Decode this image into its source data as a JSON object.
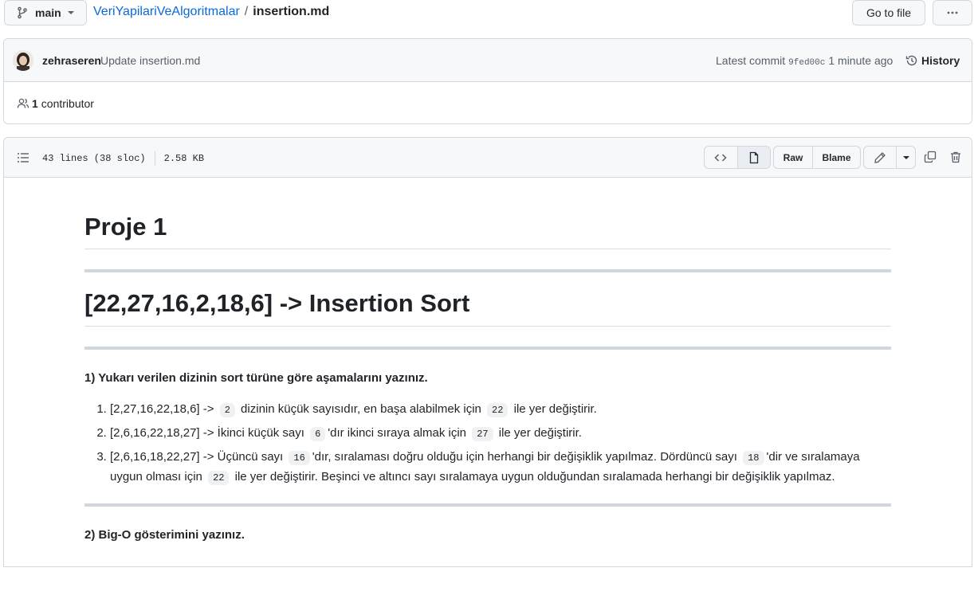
{
  "topbar": {
    "branch": "main",
    "repo": "VeriYapilariVeAlgoritmalar",
    "separator": "/",
    "file": "insertion.md",
    "goto_file": "Go to file",
    "more_icon": "kebab-horizontal-icon"
  },
  "commit": {
    "author": "zehraseren",
    "message": "Update insertion.md",
    "latest_label": "Latest commit",
    "sha": "9fed00c",
    "time": "1 minute ago",
    "history_label": "History",
    "contributors_count": "1",
    "contributors_label": "contributor"
  },
  "file_header": {
    "lines": "43 lines (38 sloc)",
    "size": "2.58 KB",
    "raw_label": "Raw",
    "blame_label": "Blame"
  },
  "markdown": {
    "h1_title": "Proje 1",
    "h1_sort": "[22,27,16,2,18,6] -> Insertion Sort",
    "q1": "1) Yukarı verilen dizinin sort türüne göre aşamalarını yazınız.",
    "steps": [
      {
        "a": "[2,27,16,22,18,6] -> ",
        "c1": "2",
        "b": " dizinin küçük sayısıdır, en başa alabilmek için ",
        "c2": "22",
        "d": " ile yer değiştirir."
      },
      {
        "a": "[2,6,16,22,18,27] -> İkinci küçük sayı ",
        "c1": "6",
        "b": "'dır ikinci sıraya almak için ",
        "c2": "27",
        "d": " ile yer değiştirir."
      },
      {
        "a": "[2,6,16,18,22,27] -> Üçüncü sayı ",
        "c1": "16",
        "b": "'dır, sıralaması doğru olduğu için herhangi bir değişiklik yapılmaz. Dördüncü sayı ",
        "c2": "18",
        "d": "'dir ve sıralamaya uygun olması için ",
        "c3": "22",
        "e": " ile yer değiştirir. Beşinci ve altıncı sayı sıralamaya uygun olduğundan sıralamada herhangi bir değişiklik yapılmaz."
      }
    ],
    "q2": "2) Big-O gösterimini yazınız."
  },
  "colors": {
    "link": "#0969da",
    "border": "#d0d7de",
    "header_bg": "#f6f8fa"
  }
}
